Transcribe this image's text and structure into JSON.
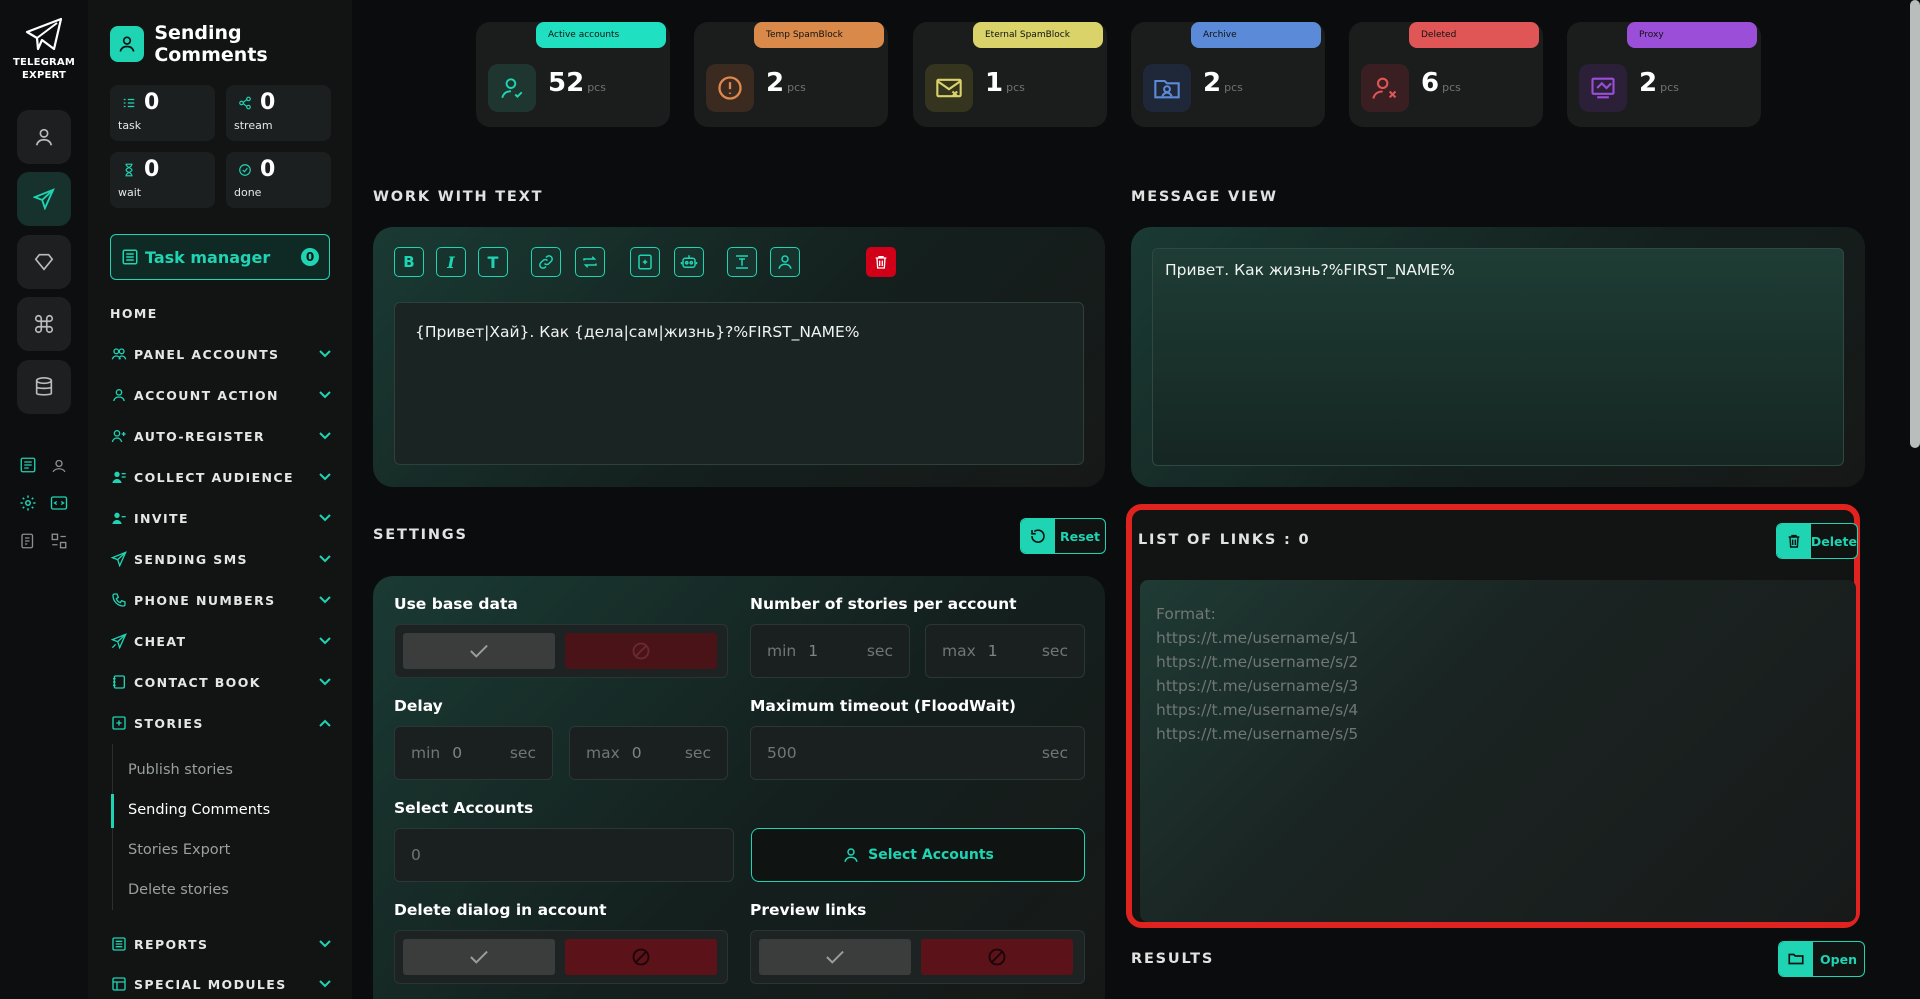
{
  "app": {
    "title": "TELEGRAM EXPERT",
    "logo_line1": "TELEGRAM",
    "logo_line2": "EXPERT",
    "page_title": "Sending Comments"
  },
  "colors": {
    "accent": "#1fd4b3",
    "danger": "#d10019",
    "highlight": "#e0231e"
  },
  "counters": [
    {
      "value": "0",
      "label": "task",
      "icon": "task-icon"
    },
    {
      "value": "0",
      "label": "stream",
      "icon": "stream-icon"
    },
    {
      "value": "0",
      "label": "wait",
      "icon": "hourglass-icon"
    },
    {
      "value": "0",
      "label": "done",
      "icon": "check-circle-icon"
    }
  ],
  "task_manager": {
    "label": "Task manager",
    "count": "0"
  },
  "nav": {
    "home": "HOME",
    "items": [
      {
        "label": "PANEL ACCOUNTS",
        "icon": "users-icon",
        "expanded": false
      },
      {
        "label": "ACCOUNT ACTION",
        "icon": "user-icon",
        "expanded": false
      },
      {
        "label": "AUTO-REGISTER",
        "icon": "user-plus-icon",
        "expanded": false
      },
      {
        "label": "COLLECT AUDIENCE",
        "icon": "audience-icon",
        "expanded": false
      },
      {
        "label": "INVITE",
        "icon": "invite-icon",
        "expanded": false
      },
      {
        "label": "SENDING SMS",
        "icon": "send-icon",
        "expanded": false
      },
      {
        "label": "PHONE NUMBERS",
        "icon": "phone-icon",
        "expanded": false
      },
      {
        "label": "CHEAT",
        "icon": "cheat-icon",
        "expanded": false
      },
      {
        "label": "CONTACT BOOK",
        "icon": "book-icon",
        "expanded": false
      },
      {
        "label": "STORIES",
        "icon": "stories-icon",
        "expanded": true
      },
      {
        "label": "REPORTS",
        "icon": "reports-icon",
        "expanded": false
      },
      {
        "label": "SPECIAL MODULES",
        "icon": "modules-icon",
        "expanded": false
      }
    ],
    "stories_sub": [
      "Publish stories",
      "Sending Comments",
      "Stories Export",
      "Delete stories"
    ],
    "active_sub": "Sending Comments"
  },
  "account_stats": [
    {
      "label": "Active accounts",
      "value": "52",
      "unit": "pcs",
      "color": "#1fe0c0",
      "icon": "active-user-icon"
    },
    {
      "label": "Temp SpamBlock",
      "value": "2",
      "unit": "pcs",
      "color": "#d98a4a",
      "icon": "warning-icon"
    },
    {
      "label": "Eternal SpamBlock",
      "value": "1",
      "unit": "pcs",
      "color": "#d9d36a",
      "icon": "mail-block-icon"
    },
    {
      "label": "Archive",
      "value": "2",
      "unit": "pcs",
      "color": "#5b8ad8",
      "icon": "archive-icon"
    },
    {
      "label": "Deleted",
      "value": "6",
      "unit": "pcs",
      "color": "#e05555",
      "icon": "user-x-icon"
    },
    {
      "label": "Proxy",
      "value": "2",
      "unit": "pcs",
      "color": "#9b4fd9",
      "icon": "proxy-icon"
    }
  ],
  "work_with_text": {
    "title": "WORK WITH TEXT",
    "toolbar": [
      "B",
      "I",
      "T",
      "link-icon",
      "repeat-icon",
      "file-add-icon",
      "bot-icon",
      "text-block-icon",
      "person-icon",
      "trash-icon"
    ],
    "text": "{Привет|Хай}. Как {дела|сам|жизнь}?%FIRST_NAME%"
  },
  "message_view": {
    "title": "MESSAGE VIEW",
    "text": "Привет. Как жизнь?%FIRST_NAME%"
  },
  "settings": {
    "title": "SETTINGS",
    "reset_label": "Reset",
    "use_base_data": "Use base data",
    "stories_per_account": "Number of stories per account",
    "stories_min": {
      "prefix": "min",
      "value": "1",
      "unit": "sec"
    },
    "stories_max": {
      "prefix": "max",
      "value": "1",
      "unit": "sec"
    },
    "delay": "Delay",
    "delay_min": {
      "prefix": "min",
      "value": "0",
      "unit": "sec"
    },
    "delay_max": {
      "prefix": "max",
      "value": "0",
      "unit": "sec"
    },
    "max_timeout": "Maximum timeout (FloodWait)",
    "max_timeout_value": {
      "value": "500",
      "unit": "sec"
    },
    "select_accounts": "Select Accounts",
    "select_accounts_value": "0",
    "select_accounts_button": "Select Accounts",
    "delete_dialog": "Delete dialog in account",
    "preview_links": "Preview links"
  },
  "links": {
    "title": "LIST OF LINKS : 0",
    "delete_label": "Delete",
    "placeholder_lines": [
      "Format:",
      "https://t.me/username/s/1",
      "https://t.me/username/s/2",
      "https://t.me/username/s/3",
      "https://t.me/username/s/4",
      "https://t.me/username/s/5"
    ]
  },
  "results": {
    "title": "RESULTS",
    "open_label": "Open"
  }
}
